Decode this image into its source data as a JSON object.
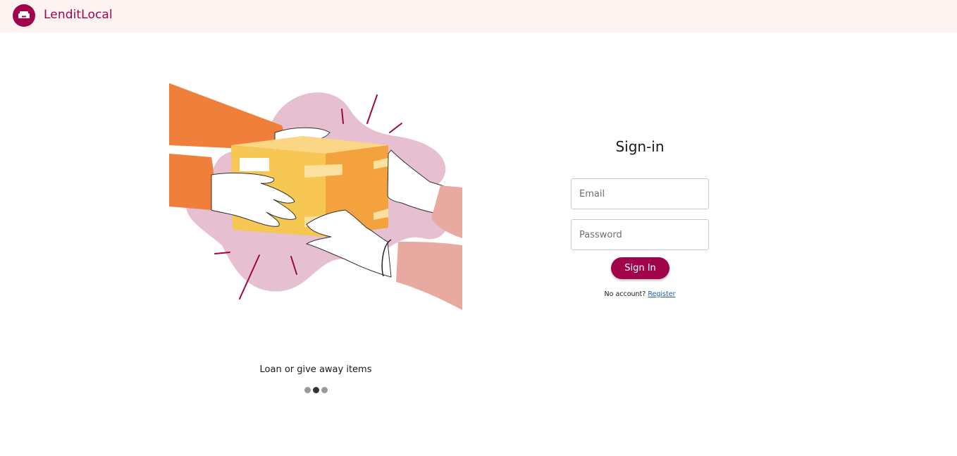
{
  "app": {
    "brand_name": "LenditLocal",
    "brand_color": "#a1044a",
    "header_bg": "#fdf3f1",
    "logo_icon": "sofa-icon"
  },
  "carousel": {
    "caption": "Loan or give away items",
    "slide_count": 3,
    "active_index": 1
  },
  "signin": {
    "title": "Sign-in",
    "email_placeholder": "Email",
    "password_placeholder": "Password",
    "button_label": "Sign In",
    "no_account_text": "No account?",
    "register_label": "Register"
  }
}
